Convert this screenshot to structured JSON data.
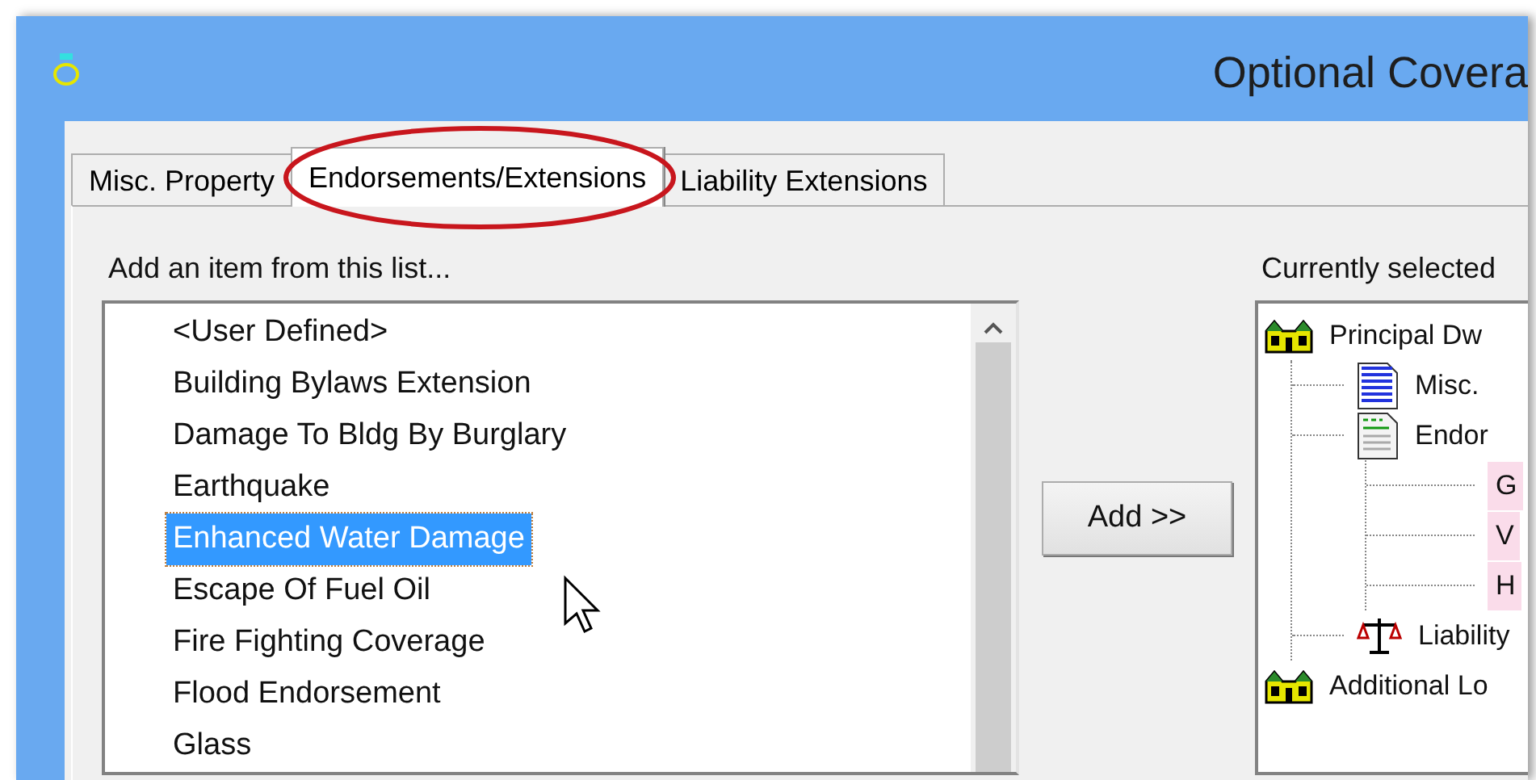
{
  "window": {
    "title": "Optional Covera"
  },
  "tabs": [
    {
      "label": "Misc. Property",
      "selected": false
    },
    {
      "label": "Endorsements/Extensions",
      "selected": true
    },
    {
      "label": "Liability Extensions",
      "selected": false
    }
  ],
  "available_list": {
    "label": "Add an item from this list...",
    "items": [
      {
        "label": "<User Defined>",
        "selected": false
      },
      {
        "label": "Building Bylaws Extension",
        "selected": false
      },
      {
        "label": "Damage To Bldg By Burglary",
        "selected": false
      },
      {
        "label": "Earthquake",
        "selected": false
      },
      {
        "label": "Enhanced Water Damage",
        "selected": true
      },
      {
        "label": "Escape Of Fuel Oil",
        "selected": false
      },
      {
        "label": "Fire Fighting Coverage",
        "selected": false
      },
      {
        "label": "Flood Endorsement",
        "selected": false
      },
      {
        "label": "Glass",
        "selected": false
      }
    ]
  },
  "add_button": {
    "label": "Add >>"
  },
  "selected_tree": {
    "label": "Currently selected",
    "items": [
      {
        "label": "Principal Dw",
        "kind": "house",
        "highlighted": false,
        "children": [
          {
            "label": "Misc.",
            "kind": "lined-document",
            "highlighted": false
          },
          {
            "label": "Endor",
            "kind": "form-document",
            "highlighted": false,
            "children": [
              {
                "label": "G",
                "kind": "none",
                "highlighted": true
              },
              {
                "label": "V",
                "kind": "none",
                "highlighted": true
              },
              {
                "label": "H",
                "kind": "none",
                "highlighted": true
              }
            ]
          },
          {
            "label": "Liability",
            "kind": "scales",
            "highlighted": false
          }
        ]
      },
      {
        "label": "Additional Lo",
        "kind": "house",
        "highlighted": false
      }
    ]
  }
}
